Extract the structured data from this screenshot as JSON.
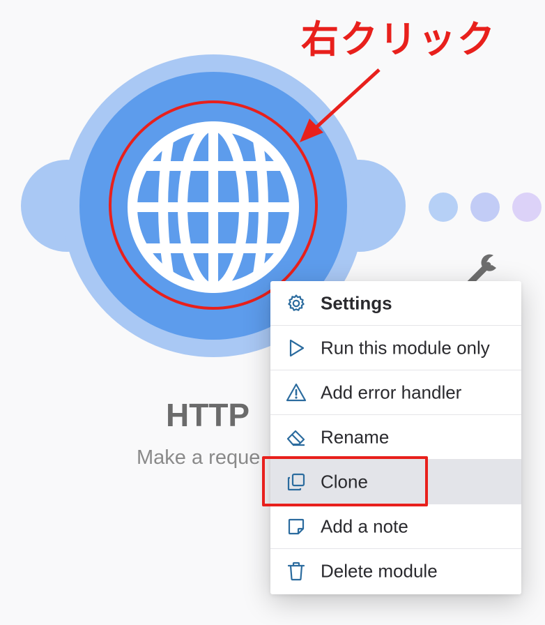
{
  "annotation": {
    "label": "右クリック",
    "color": "#e8201c"
  },
  "module": {
    "title": "HTTP",
    "subtitle": "Make a reque",
    "icon": "globe-icon",
    "colors": {
      "halo": "#a9c8f4",
      "body": "#5d9cec",
      "glyph": "#ffffff"
    }
  },
  "connector": {
    "dot_colors": [
      "#b6d0f6",
      "#c2ccf6",
      "#dcd2f8"
    ]
  },
  "context_menu": {
    "items": [
      {
        "label": "Settings",
        "icon": "gear-icon",
        "name": "settings"
      },
      {
        "label": "Run this module only",
        "icon": "play-icon",
        "name": "run-this-module-only"
      },
      {
        "label": "Add error handler",
        "icon": "warning-icon",
        "name": "add-error-handler"
      },
      {
        "label": "Rename",
        "icon": "eraser-icon",
        "name": "rename"
      },
      {
        "label": "Clone",
        "icon": "copy-icon",
        "name": "clone"
      },
      {
        "label": "Add a note",
        "icon": "note-icon",
        "name": "add-a-note"
      },
      {
        "label": "Delete module",
        "icon": "trash-icon",
        "name": "delete-module"
      }
    ],
    "active_item": "Clone",
    "icon_color": "#2b6b9e"
  }
}
